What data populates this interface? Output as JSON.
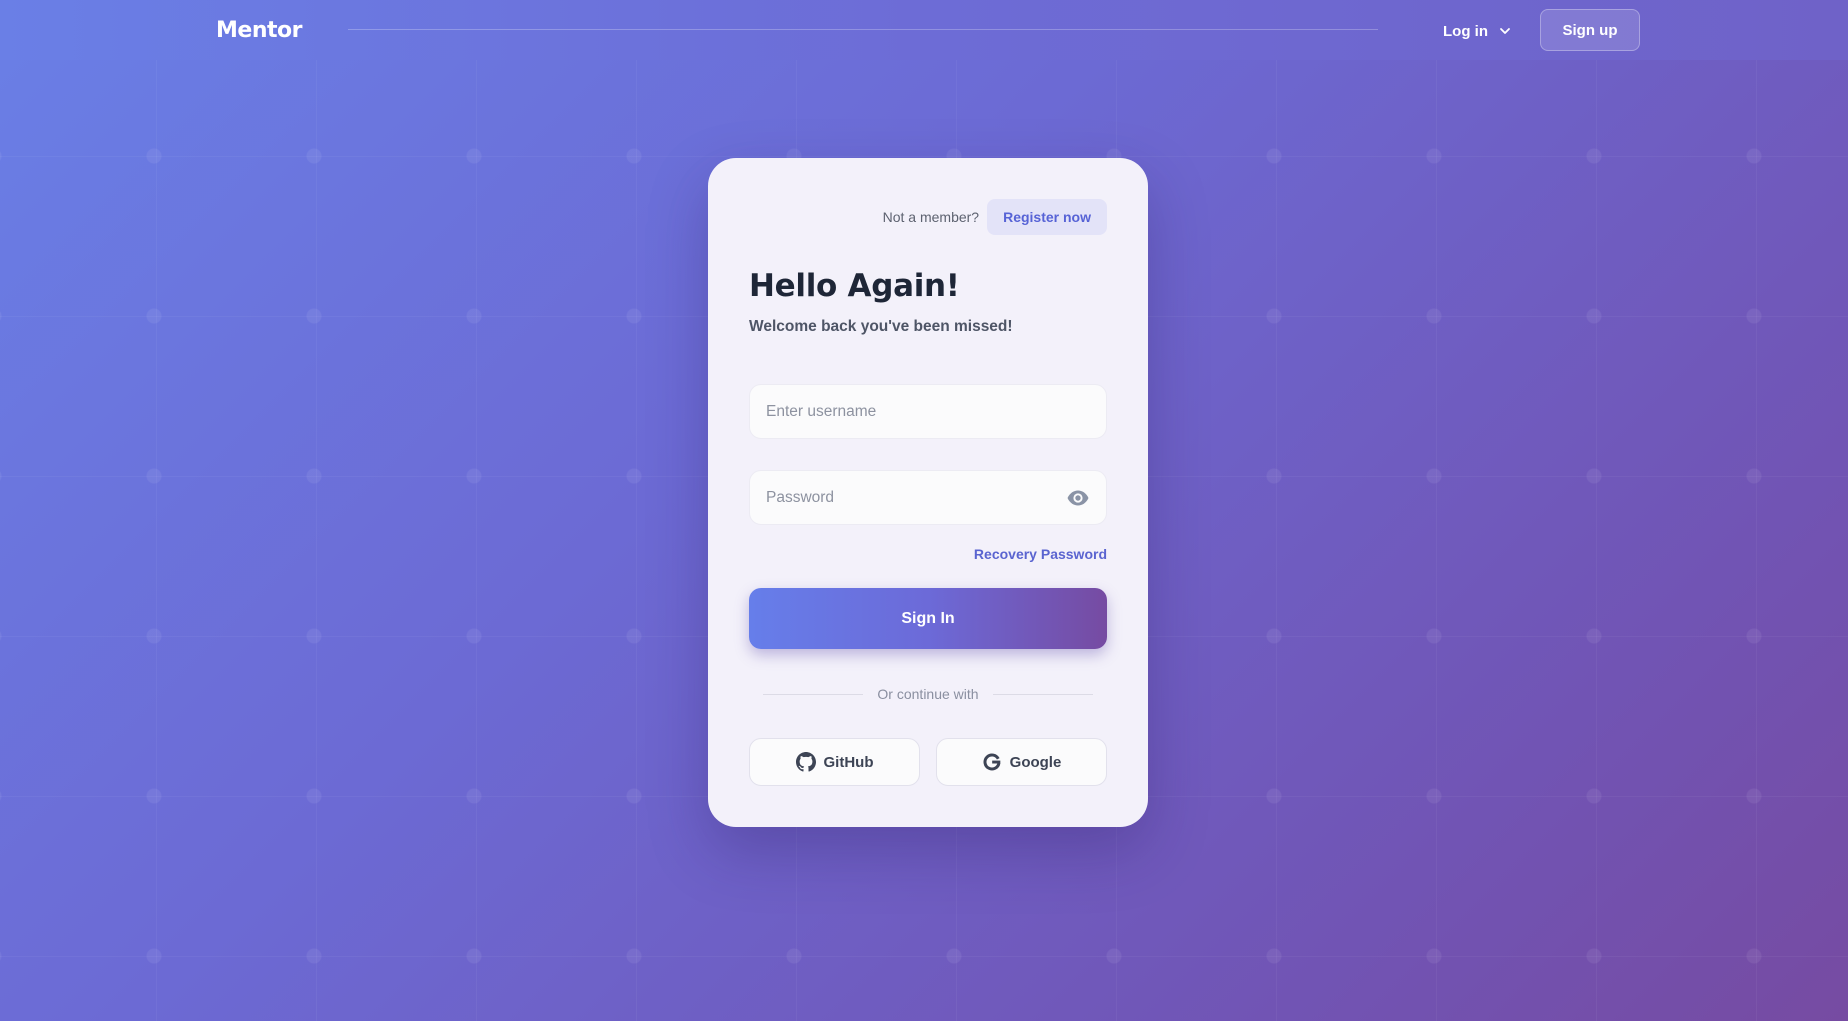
{
  "header": {
    "logo": "Mentor",
    "login_label": "Log in",
    "signup_label": "Sign up"
  },
  "card": {
    "member_prompt": "Not a member?",
    "register_label": "Register now",
    "title": "Hello Again!",
    "subtitle": "Welcome back you've been missed!",
    "username": {
      "placeholder": "Enter username",
      "value": ""
    },
    "password": {
      "placeholder": "Password",
      "value": ""
    },
    "recovery_label": "Recovery Password",
    "signin_label": "Sign In",
    "divider_text": "Or continue with",
    "social": [
      {
        "label": "GitHub",
        "icon": "github-icon"
      },
      {
        "label": "Google",
        "icon": "google-icon"
      }
    ]
  },
  "colors": {
    "gradient_start": "#667eea",
    "gradient_end": "#764ba2",
    "accent_link": "#5a64d0",
    "card_bg": "#f3f1fa",
    "title_text": "#1e2637"
  }
}
